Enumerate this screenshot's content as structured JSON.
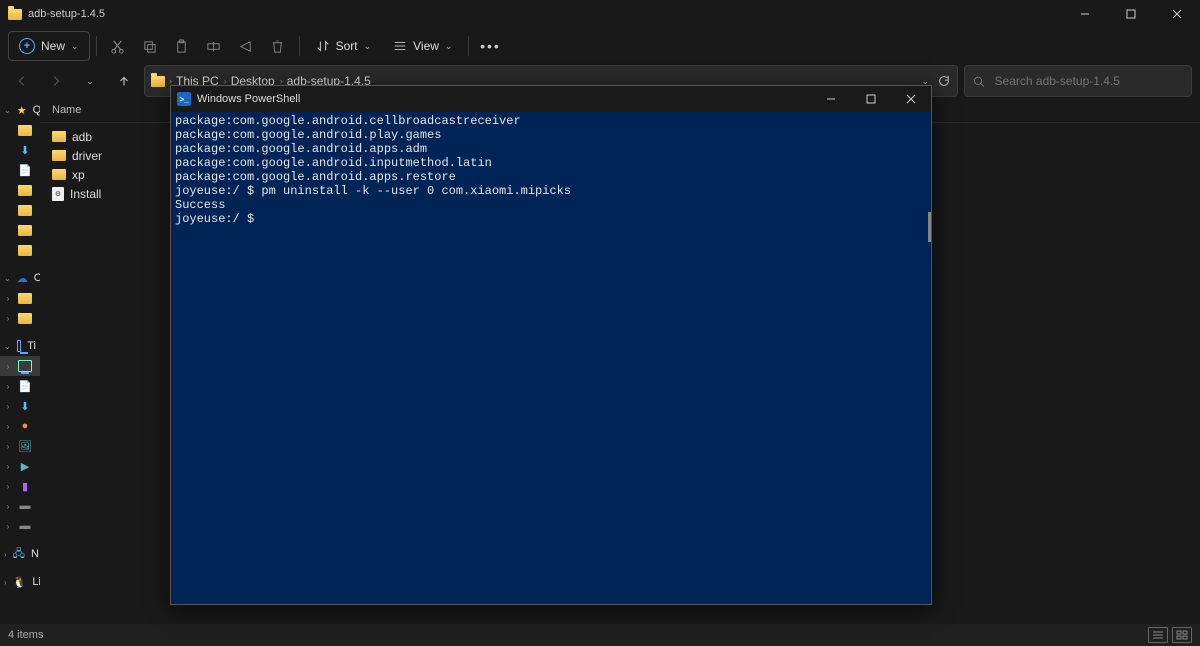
{
  "window": {
    "title": "adb-setup-1.4.5"
  },
  "toolbar": {
    "new": "New",
    "sort": "Sort",
    "view": "View"
  },
  "breadcrumbs": [
    "This PC",
    "Desktop",
    "adb-setup-1.4.5"
  ],
  "search": {
    "placeholder": "Search adb-setup-1.4.5"
  },
  "sidebar": {
    "quick": "Q",
    "onedrive": "O",
    "thispc": "Ti",
    "network": "N",
    "linux": "Li"
  },
  "columns": {
    "name": "Name"
  },
  "files": [
    {
      "type": "folder",
      "name": "adb"
    },
    {
      "type": "folder",
      "name": "driver"
    },
    {
      "type": "folder",
      "name": "xp"
    },
    {
      "type": "bat",
      "name": "Install"
    }
  ],
  "status": {
    "count": "4 items"
  },
  "powershell": {
    "title": "Windows PowerShell",
    "lines": [
      "package:com.google.android.cellbroadcastreceiver",
      "package:com.google.android.play.games",
      "package:com.google.android.apps.adm",
      "package:com.google.android.inputmethod.latin",
      "package:com.google.android.apps.restore",
      "joyeuse:/ $ pm uninstall -k --user 0 com.xiaomi.mipicks",
      "Success",
      "joyeuse:/ $"
    ]
  }
}
